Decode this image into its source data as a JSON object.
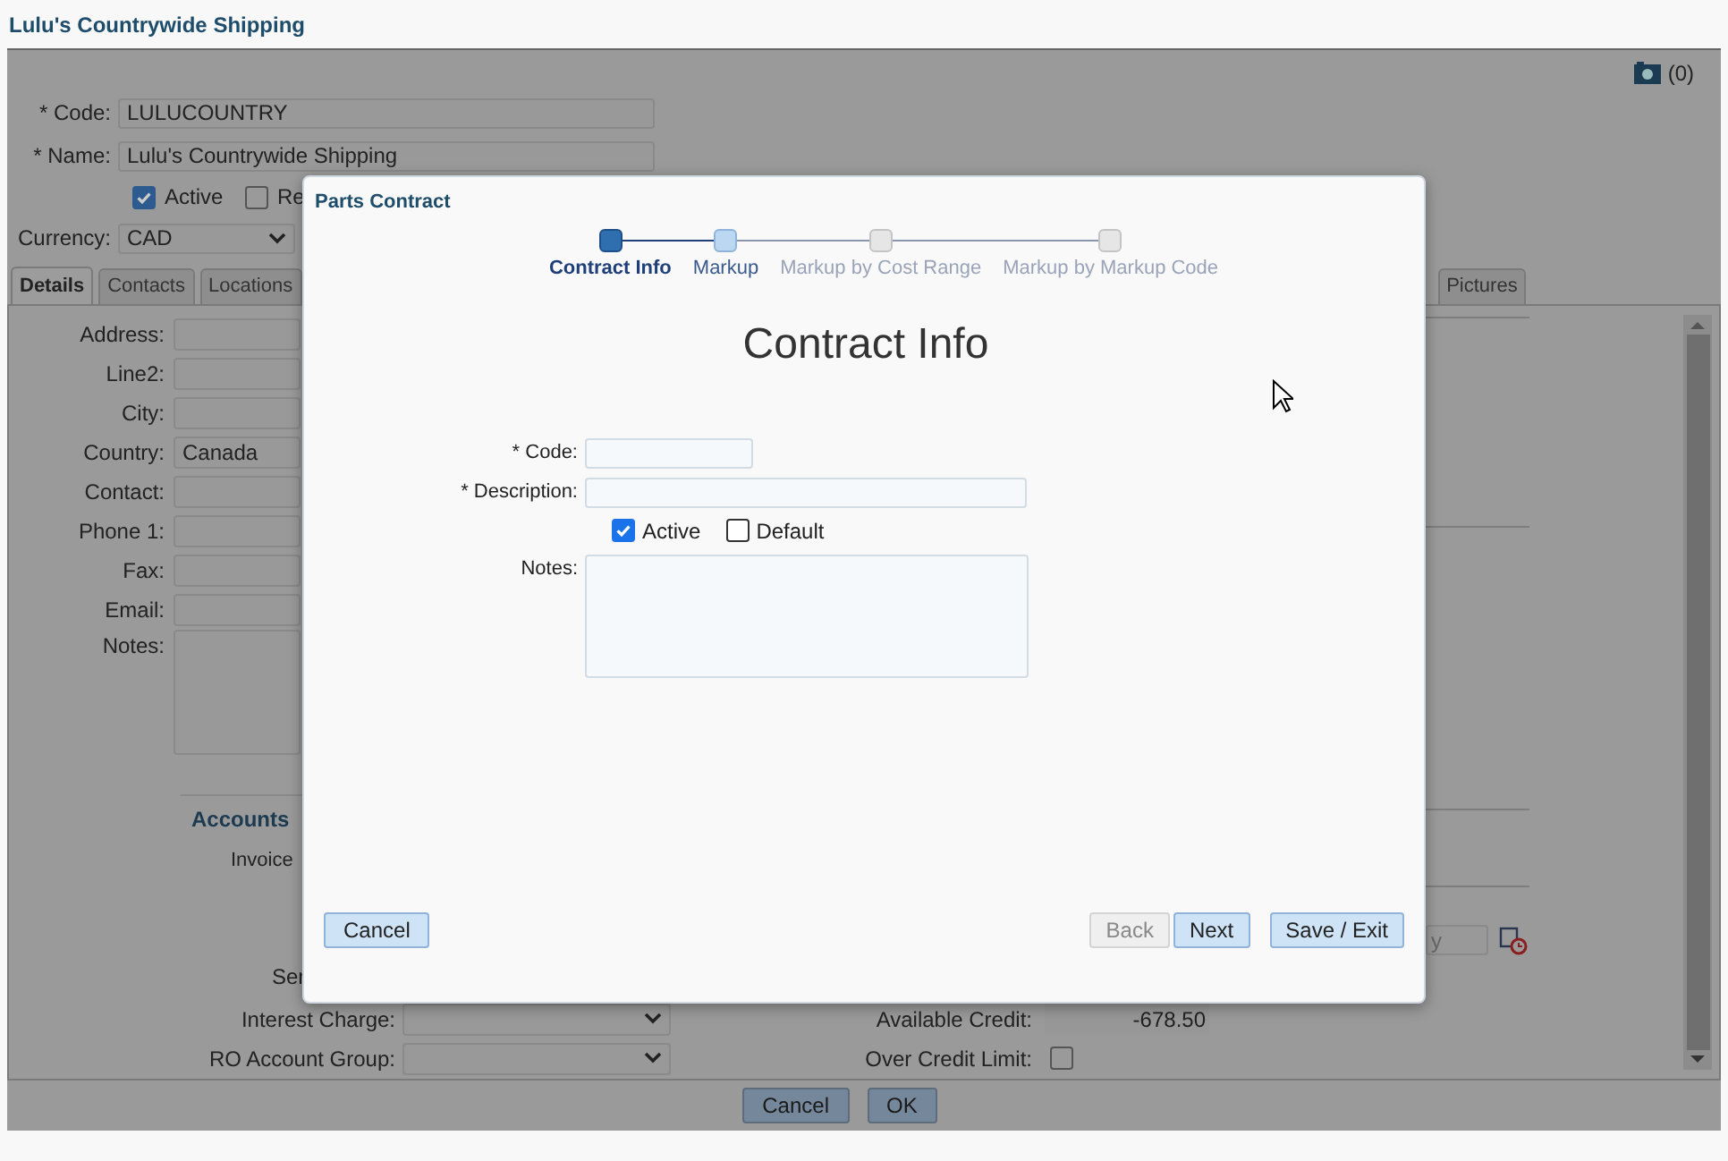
{
  "window": {
    "title": "Lulu's Countrywide Shipping"
  },
  "attachments": {
    "count": "(0)"
  },
  "header_form": {
    "code": {
      "label": "* Code:",
      "value": "LULUCOUNTRY"
    },
    "name": {
      "label": "* Name:",
      "value": "Lulu's Countrywide Shipping"
    },
    "checkboxes": [
      {
        "label": "Active",
        "checked": true
      },
      {
        "label": "Re",
        "checked": false
      }
    ],
    "currency": {
      "label": "Currency:",
      "value": "CAD"
    }
  },
  "tabs": [
    {
      "label": "Details",
      "selected": true
    },
    {
      "label": "Contacts",
      "selected": false
    },
    {
      "label": "Locations",
      "selected": false
    },
    {
      "label": "Pictures",
      "selected": false
    }
  ],
  "details": {
    "fields": [
      {
        "label": "Address:",
        "kind": "text"
      },
      {
        "label": "Line2:",
        "kind": "text"
      },
      {
        "label": "City:",
        "kind": "text"
      },
      {
        "label": "Country:",
        "kind": "text",
        "value": "Canada"
      },
      {
        "label": "Contact:",
        "kind": "text"
      },
      {
        "label": "Phone 1:",
        "kind": "text"
      },
      {
        "label": "Fax:",
        "kind": "text"
      },
      {
        "label": "Email:",
        "kind": "text"
      },
      {
        "label": "Notes:",
        "kind": "textarea"
      }
    ]
  },
  "accounts": {
    "title": "Accounts",
    "labels": [
      "Invoice",
      "Ser"
    ]
  },
  "date_field": {
    "placeholder": "y"
  },
  "account_rows": [
    {
      "label": "Interest Charge:"
    },
    {
      "label": "RO Account Group:"
    }
  ],
  "credit": [
    {
      "label": "Available Credit:",
      "kind": "value",
      "value": "-678.50"
    },
    {
      "label": "Over Credit Limit:",
      "kind": "checkbox",
      "checked": false
    }
  ],
  "footer_buttons": [
    {
      "label": "Cancel"
    },
    {
      "label": "OK"
    }
  ],
  "dialog": {
    "title": "Parts Contract",
    "steps": [
      {
        "label": "Contract Info",
        "selected": true,
        "disabled": false
      },
      {
        "label": "Markup",
        "selected": false,
        "disabled": false
      },
      {
        "label": "Markup by Cost Range",
        "selected": false,
        "disabled": true
      },
      {
        "label": "Markup by Markup Code",
        "selected": false,
        "disabled": true
      }
    ],
    "heading": "Contract Info",
    "fields": [
      {
        "label": "* Code:",
        "kind": "short"
      },
      {
        "label": "* Description:",
        "kind": "long"
      },
      {
        "kind": "checkboxes",
        "options": [
          {
            "label": "Active",
            "checked": true
          },
          {
            "label": "Default",
            "checked": false
          }
        ]
      },
      {
        "label": "Notes:",
        "kind": "textarea"
      }
    ],
    "buttons_left": [
      {
        "label": "Cancel"
      }
    ],
    "buttons_right": [
      {
        "label": "Back",
        "disabled": true
      },
      {
        "label": "Next",
        "disabled": false
      },
      {
        "label": "Save / Exit",
        "disabled": false
      }
    ]
  }
}
